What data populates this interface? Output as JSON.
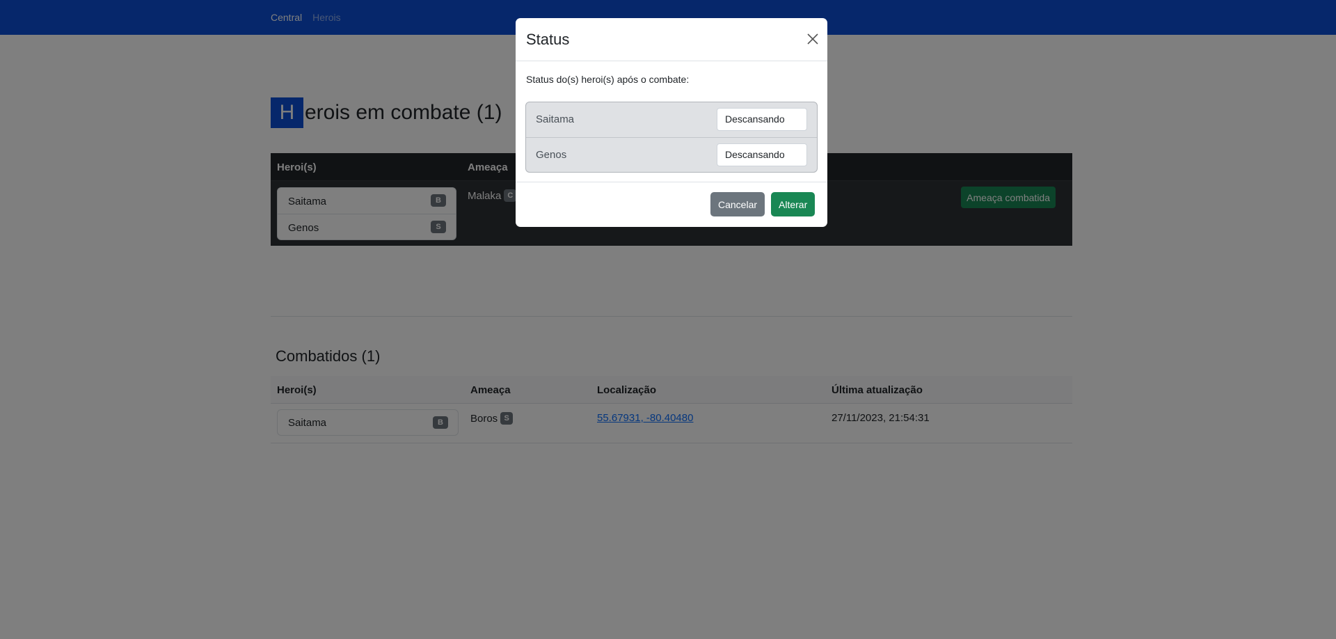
{
  "navbar": {
    "links": [
      {
        "label": "Central",
        "active": true
      },
      {
        "label": "Herois",
        "active": false
      }
    ]
  },
  "page_heading": {
    "first_letter": "H",
    "rest": "erois em combate (1)"
  },
  "combat_table": {
    "headers": [
      "Heroi(s)",
      "Ameaça"
    ],
    "rows": [
      {
        "heroes": [
          {
            "name": "Saitama",
            "rank": "B"
          },
          {
            "name": "Genos",
            "rank": "S"
          }
        ],
        "threat": {
          "name": "Malaka",
          "level": "C"
        },
        "action_label": "Ameaça combatida"
      }
    ]
  },
  "fought_section": {
    "title": "Combatidos (1)",
    "headers": [
      "Heroi(s)",
      "Ameaça",
      "Localização",
      "Última atualização"
    ],
    "rows": [
      {
        "heroes": [
          {
            "name": "Saitama",
            "rank": "B"
          }
        ],
        "threat": {
          "name": "Boros",
          "level": "S"
        },
        "location": "55.67931, -80.40480",
        "updated": "27/11/2023, 21:54:31"
      }
    ]
  },
  "modal": {
    "title": "Status",
    "description": "Status do(s) heroi(s) após o combate:",
    "heroes": [
      {
        "name": "Saitama",
        "status": "Descansando"
      },
      {
        "name": "Genos",
        "status": "Descansando"
      }
    ],
    "cancel_label": "Cancelar",
    "confirm_label": "Alterar"
  },
  "colors": {
    "primary": "#0d4fd6",
    "success": "#198754",
    "secondary": "#6c757d",
    "dark": "#212529"
  }
}
